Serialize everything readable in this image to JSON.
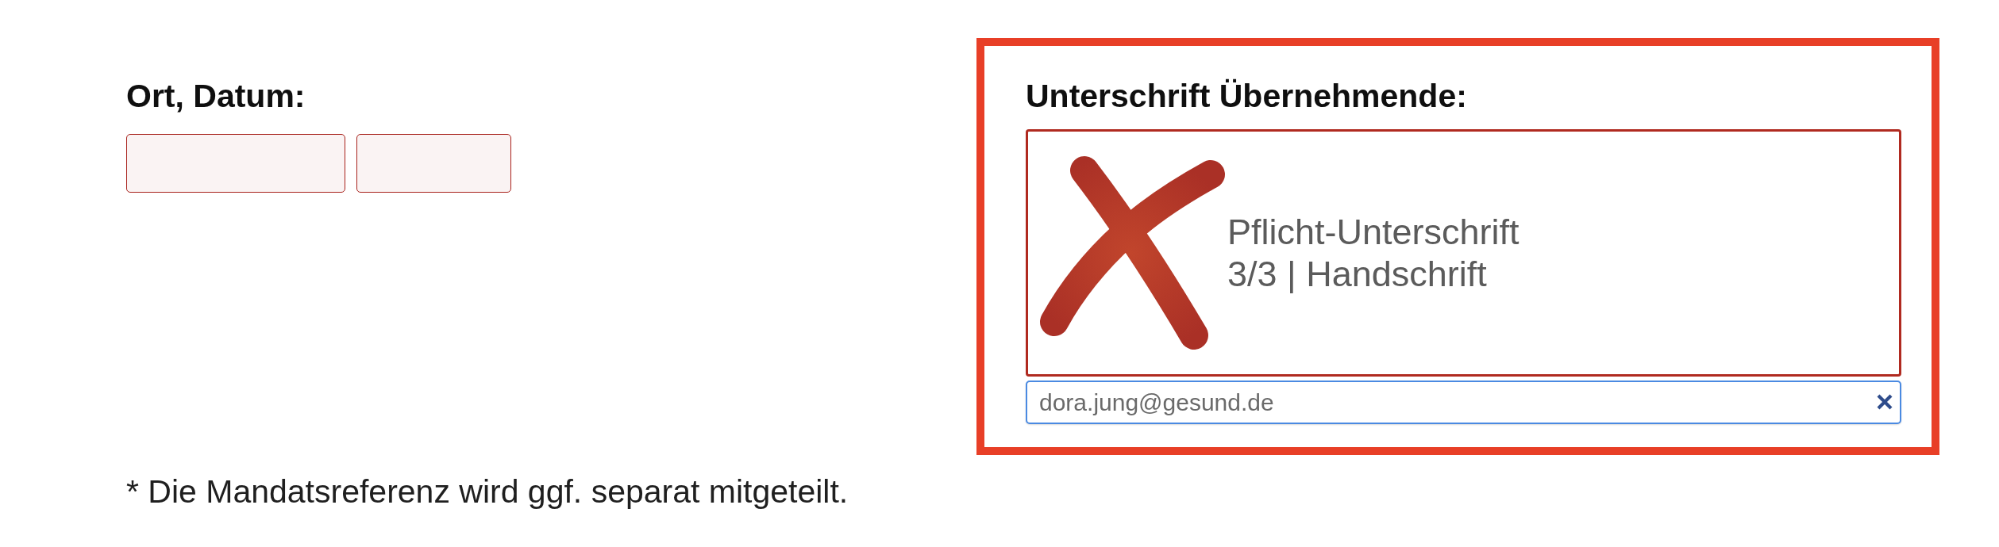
{
  "place_date": {
    "label": "Ort, Datum:",
    "fields": [
      {
        "invalid": true
      },
      {
        "invalid": true
      }
    ]
  },
  "signature": {
    "highlighted": true,
    "label": "Unterschrift Übernehmende:",
    "required": true,
    "status": "Pflicht-Unterschrift",
    "detail": "3/3 | Handschrift",
    "email": {
      "value": "dora.jung@gesund.de",
      "focused": true
    }
  },
  "footnote": "* Die Mandatsreferenz wird ggf. separat mitgeteilt."
}
